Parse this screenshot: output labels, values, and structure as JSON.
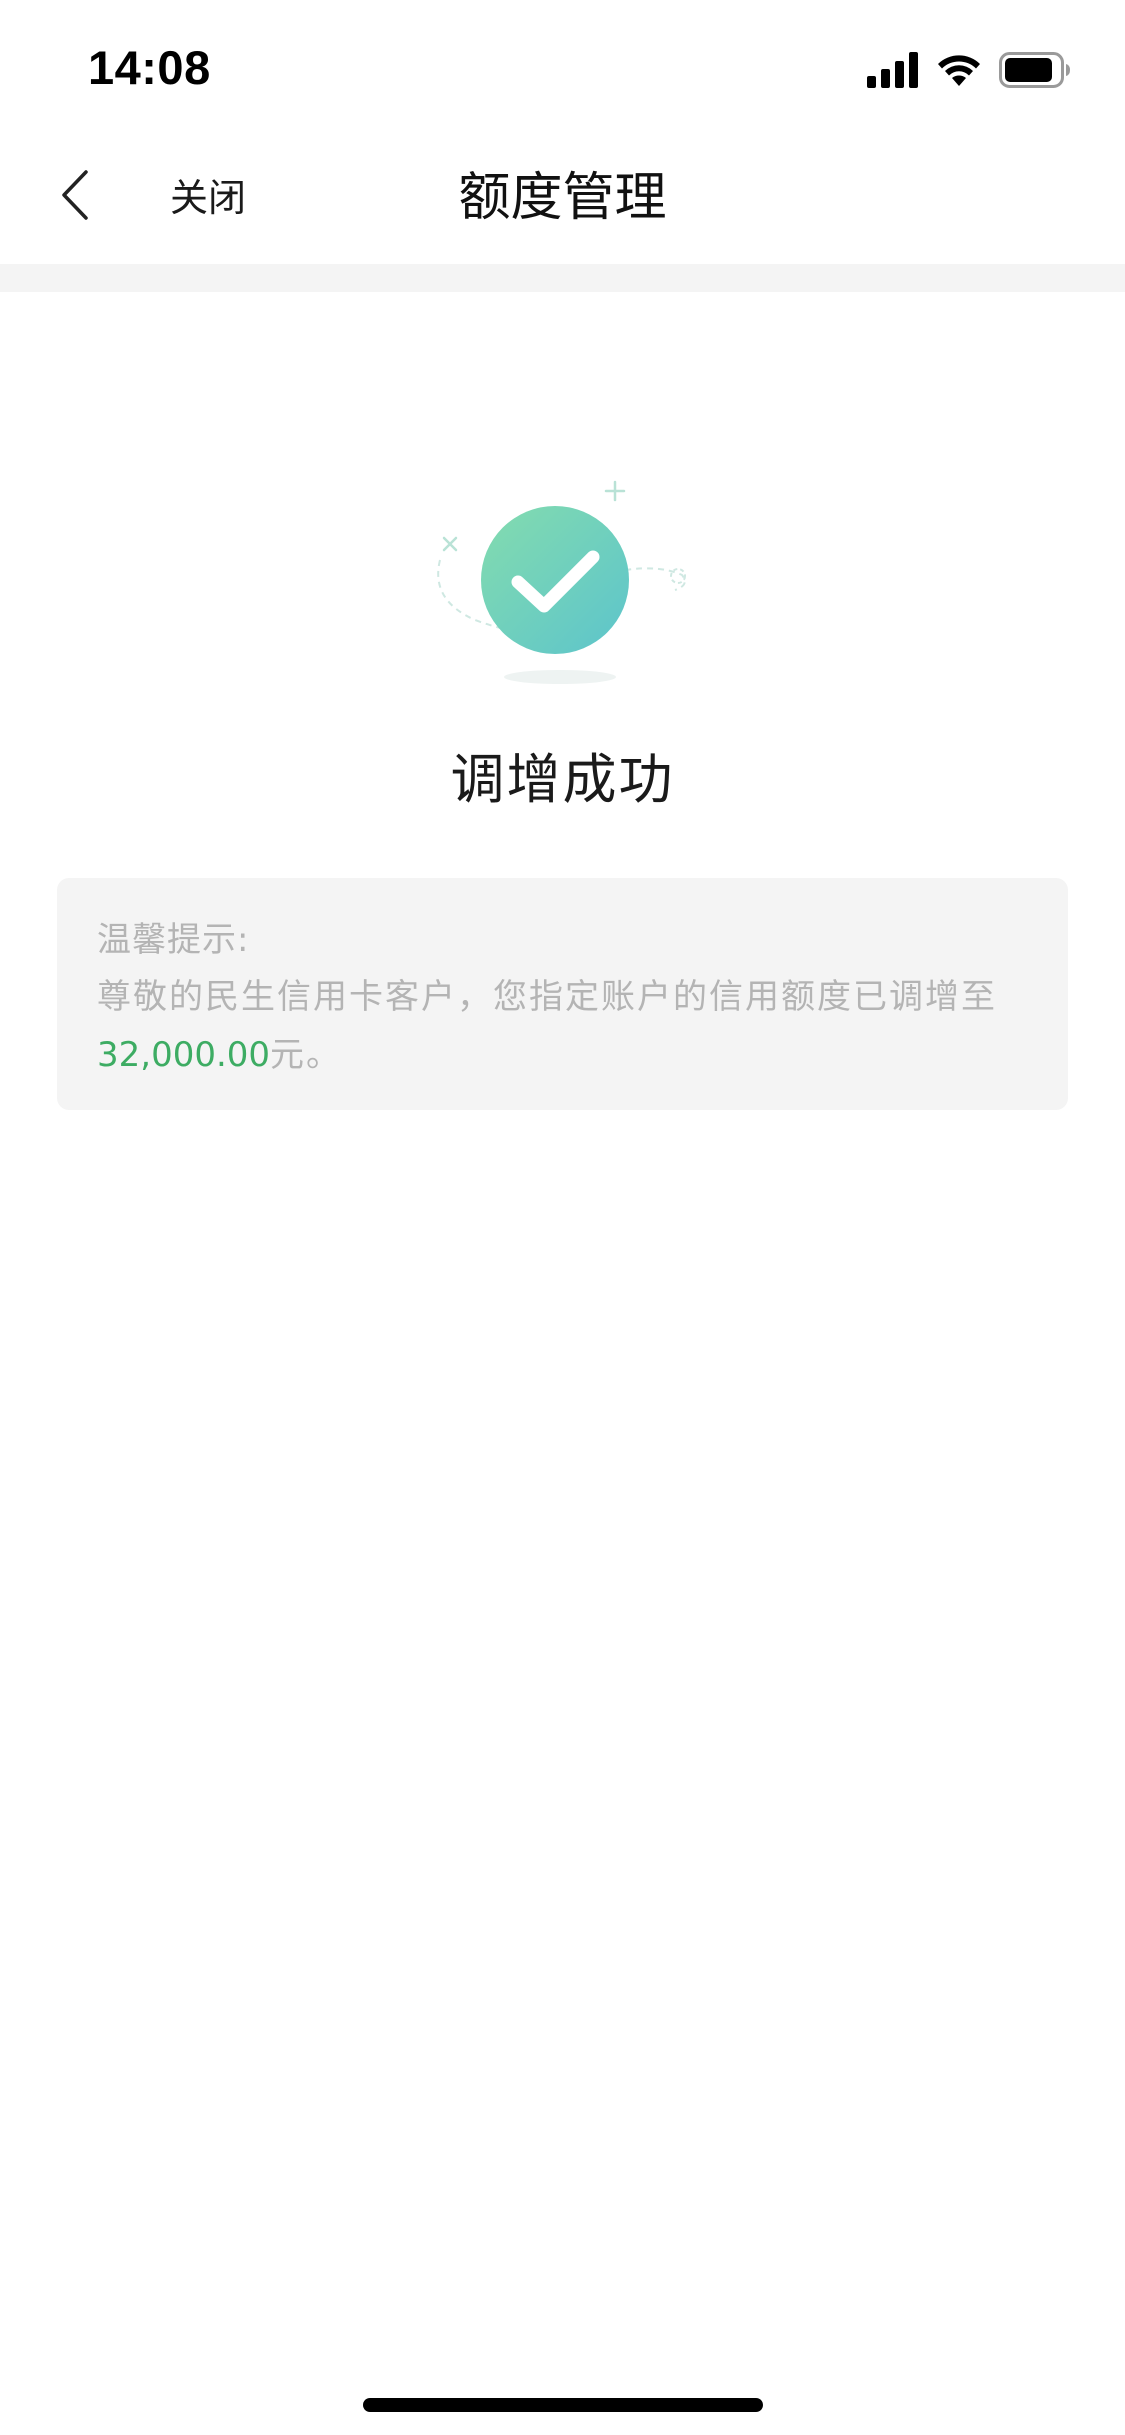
{
  "status_bar": {
    "time": "14:08",
    "icons": [
      "signal-icon",
      "wifi-icon",
      "battery-icon"
    ]
  },
  "nav": {
    "back_icon": "chevron-left-icon",
    "close_label": "关闭",
    "title": "额度管理"
  },
  "result": {
    "icon": "check-circle-icon",
    "title": "调增成功"
  },
  "tip": {
    "label": "温馨提示:",
    "message_prefix": "尊敬的民生信用卡客户，您指定账户的信用额度已调增至",
    "amount": "32,000.00",
    "message_suffix": "元。"
  },
  "colors": {
    "accent_green": "#3dac63",
    "check_gradient_start": "#7bd9b0",
    "check_gradient_end": "#5ec8c8",
    "tip_text": "#b4b4b4",
    "tip_background": "#f4f4f4"
  }
}
